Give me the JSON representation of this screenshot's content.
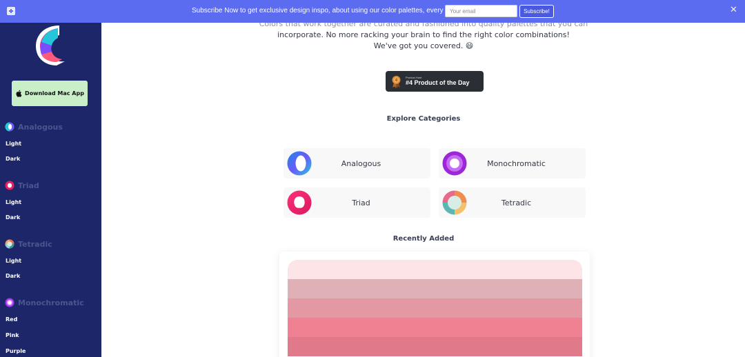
{
  "banner": {
    "message": "Subscribe Now to get exclusive design inspo, about using our color palettes, every week!",
    "email_placeholder": "Your email",
    "subscribe_label": "Subscribe!",
    "close_symbol": "✕"
  },
  "sidebar": {
    "download_label": "Download Mac App",
    "groups": [
      {
        "label": "Analogous",
        "items": [
          "Light",
          "Dark"
        ]
      },
      {
        "label": "Triad",
        "items": [
          "Light",
          "Dark"
        ]
      },
      {
        "label": "Tetradic",
        "items": [
          "Light",
          "Dark"
        ]
      },
      {
        "label": "Monochromatic",
        "items": [
          "Red",
          "Pink",
          "Purple"
        ]
      }
    ]
  },
  "main": {
    "intro_line1": "Colors that work together are curated and fashioned into quality palettes that you can",
    "intro_line2": "incorporate. No more racking your brain to find the right color combinations!",
    "intro_line3": "We've got you covered. 😄",
    "product_hunt_small": "Product Hunt",
    "product_hunt_big": "#4 Product of the Day",
    "explore_title": "Explore Categories",
    "categories": [
      "Analogous",
      "Monochromatic",
      "Triad",
      "Tetradic"
    ],
    "recent_title": "Recently Added",
    "recent_palette_colors": [
      "#fde4e6",
      "#e0b0b7",
      "#e398a3",
      "#ef8193",
      "#e07a8a"
    ]
  },
  "colors": {
    "banner": "#5b6cf0",
    "sidebar": "#1c2668",
    "mac_button": "#c9efc9"
  }
}
